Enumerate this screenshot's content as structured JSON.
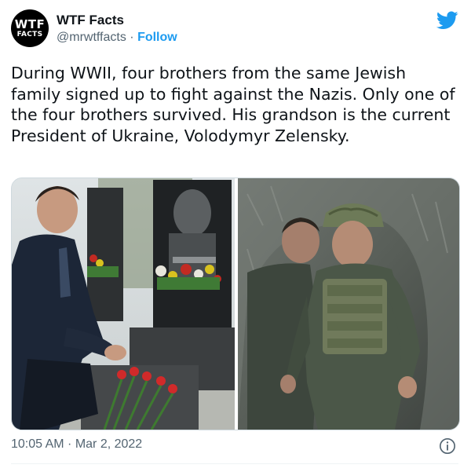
{
  "account": {
    "avatar_line1": "WTF",
    "avatar_line2": "FACTS",
    "name": "WTF Facts",
    "handle": "@mrwtffacts",
    "separator": " · ",
    "follow_label": "Follow"
  },
  "tweet": {
    "text": "During WWII, four brothers from the same Jewish family signed up to fight against the Nazis. Only one of the four brothers survived. His grandson is the current President of Ukraine, Volodymyr Zelensky.",
    "timestamp": "10:05 AM · Mar 2, 2022"
  },
  "colors": {
    "accent": "#1d9bf0",
    "text": "#0f1419",
    "secondary": "#536471"
  },
  "icons": {
    "brand": "twitter-bird-icon",
    "info": "info-icon"
  }
}
